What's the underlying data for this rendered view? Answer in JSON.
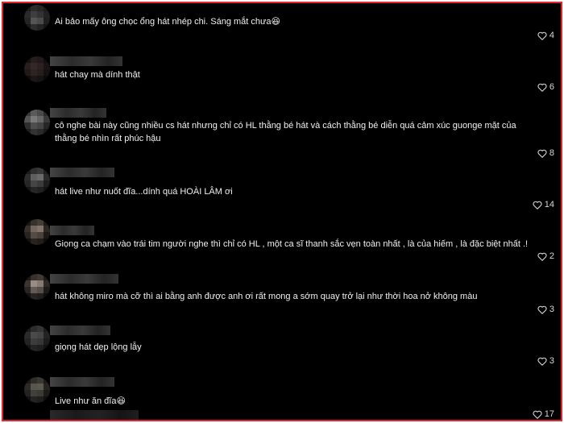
{
  "comments": [
    {
      "text": "Ai bảo mấy ông chọc ổng hát nhép chi. Sáng mắt chưa😆",
      "likes": "4"
    },
    {
      "text": "hát chay mà dính thật",
      "likes": "6"
    },
    {
      "text": "cô nghe bài này cũng nhiều cs hát nhưng chỉ có HL thằng bé hát và cách thằng bé diễn quá cảm xúc guonge mặt của thằng bé nhìn rất phúc hậu",
      "likes": "8"
    },
    {
      "text": "hát live như nuốt đĩa...dính quá HOÀI LÂM ơi",
      "likes": "14"
    },
    {
      "text": "Giọng ca chạm vào trái tim người nghe thì chỉ có HL , một ca sĩ thanh sắc vẹn toàn nhất , là của hiếm , là đặc biệt nhất .!",
      "likes": "2"
    },
    {
      "text": "hát không miro mà cỡ thì ai bằng anh được anh ơi rất mong a sớm quay trở lại như thời hoa nở không màu",
      "likes": "3"
    },
    {
      "text": "giọng hát dẹp lộng lẫy",
      "likes": "3"
    },
    {
      "text": "Live như ăn đĩa😆",
      "likes": "17"
    }
  ],
  "icons": {
    "like": "heart-outline-icon"
  }
}
